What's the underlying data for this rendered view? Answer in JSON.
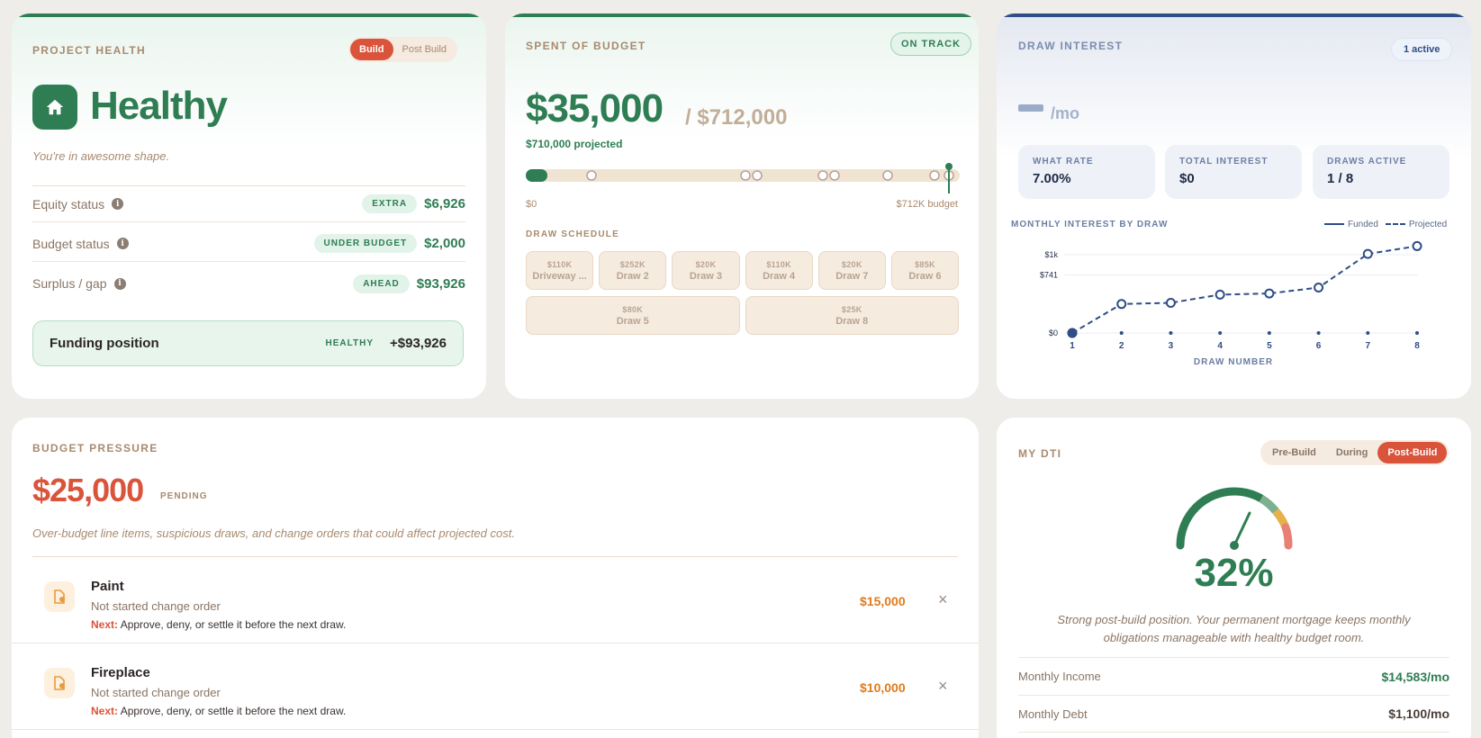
{
  "health": {
    "title": "PROJECT HEALTH",
    "toggle": [
      "Build",
      "Post Build"
    ],
    "status": "Healthy",
    "subtitle": "You're in awesome shape.",
    "rows": [
      {
        "label": "Equity status",
        "badge": "EXTRA",
        "value": "$6,926"
      },
      {
        "label": "Budget status",
        "badge": "UNDER BUDGET",
        "value": "$2,000"
      },
      {
        "label": "Surplus / gap",
        "badge": "AHEAD",
        "value": "$93,926"
      }
    ],
    "funding": {
      "label": "Funding position",
      "status": "HEALTHY",
      "value": "+$93,926"
    },
    "colors": {
      "accent": "#2e7d53",
      "toggle_active": "#d9543b"
    }
  },
  "spent": {
    "title": "SPENT OF BUDGET",
    "badge": "ON TRACK",
    "amount": "$35,000",
    "total": "/ $712,000",
    "projected": "$710,000 projected",
    "bar_start": "$0",
    "bar_end": "$712K budget",
    "progress_fraction": 0.049,
    "projected_fraction": 0.997,
    "schedule_title": "DRAW SCHEDULE",
    "schedule": [
      [
        {
          "amount": "$110K",
          "name": "Driveway ..."
        },
        {
          "amount": "$252K",
          "name": "Draw 2"
        },
        {
          "amount": "$20K",
          "name": "Draw 3"
        },
        {
          "amount": "$110K",
          "name": "Draw 4"
        },
        {
          "amount": "$20K",
          "name": "Draw 7"
        },
        {
          "amount": "$85K",
          "name": "Draw 6"
        }
      ],
      [
        {
          "amount": "$80K",
          "name": "Draw 5"
        },
        {
          "amount": "$25K",
          "name": "Draw 8"
        }
      ]
    ]
  },
  "interest": {
    "title": "DRAW INTEREST",
    "badge": "1 active",
    "per_month": "/mo",
    "stats": [
      {
        "label": "WHAT RATE",
        "value": "7.00%"
      },
      {
        "label": "TOTAL INTEREST",
        "value": "$0"
      },
      {
        "label": "DRAWS ACTIVE",
        "value": "1 / 8"
      }
    ],
    "chart_title": "MONTHLY INTEREST BY DRAW",
    "legend": [
      "Funded",
      "Projected"
    ]
  },
  "chart_data": {
    "type": "line",
    "x": [
      1,
      2,
      3,
      4,
      5,
      6,
      7,
      8
    ],
    "categories": [
      "1",
      "2",
      "3",
      "4",
      "5",
      "6",
      "7",
      "8"
    ],
    "series": [
      {
        "name": "Funded",
        "values": [
          0,
          null,
          null,
          null,
          null,
          null,
          null,
          null
        ]
      },
      {
        "name": "Projected",
        "values": [
          0,
          370,
          385,
          490,
          505,
          580,
          1010,
          1110
        ]
      }
    ],
    "yticks": [
      "$1k",
      "$741",
      "$0"
    ],
    "ytick_values": [
      1000,
      741,
      0
    ],
    "xlabel": "DRAW NUMBER",
    "ylim": [
      0,
      1300
    ]
  },
  "pressure": {
    "title": "BUDGET PRESSURE",
    "amount": "$25,000",
    "amount_label": "PENDING",
    "description": "Over-budget line items, suspicious draws, and change orders that could affect projected cost.",
    "items": [
      {
        "name": "Paint",
        "status": "Not started change order",
        "next_label": "Next:",
        "next_text": "Approve, deny, or settle it before the next draw.",
        "amount": "$15,000"
      },
      {
        "name": "Fireplace",
        "status": "Not started change order",
        "next_label": "Next:",
        "next_text": "Approve, deny, or settle it before the next draw.",
        "amount": "$10,000"
      }
    ]
  },
  "dti": {
    "title": "MY DTI",
    "toggle": [
      "Pre-Build",
      "During",
      "Post-Build"
    ],
    "value": "32%",
    "gauge_fraction": 0.32,
    "description": "Strong post-build position. Your permanent mortgage keeps monthly obligations manageable with healthy budget room.",
    "rows": [
      {
        "label": "Monthly Income",
        "value": "$14,583/mo",
        "color": "#2e7d53"
      },
      {
        "label": "Monthly Debt",
        "value": "$1,100/mo",
        "color": "#4a3f38"
      }
    ]
  }
}
